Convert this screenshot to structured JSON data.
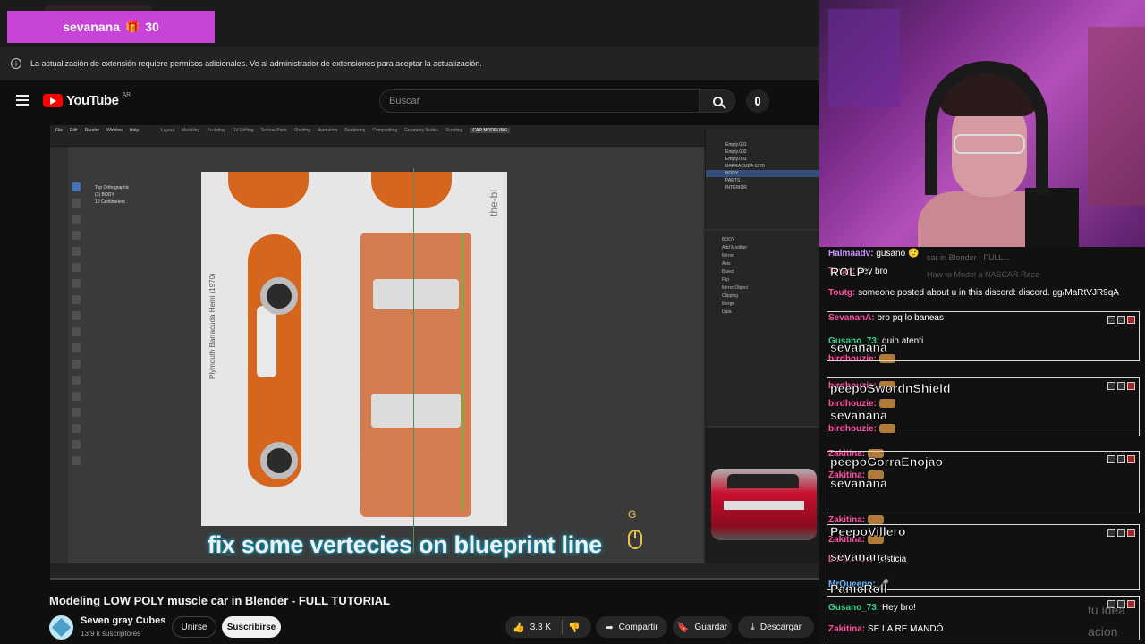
{
  "overlay": {
    "user": "sevanana",
    "gift_icon": "gift-icon",
    "count": "30"
  },
  "notice": {
    "text": "La actualización de extensión requiere permisos adicionales. Ve al administrador de extensiones para aceptar la actualización."
  },
  "header": {
    "logo": "YouTube",
    "country": "AR",
    "search_placeholder": "Buscar"
  },
  "video": {
    "subtitle": "fix some vertecies on blueprint line",
    "key_hint": "G",
    "progress": 0.0,
    "blender": {
      "menu": [
        "File",
        "Edit",
        "Render",
        "Window",
        "Help"
      ],
      "tabs": [
        "Layout",
        "Modeling",
        "Sculpting",
        "UV Editing",
        "Texture Paint",
        "Shading",
        "Animation",
        "Rendering",
        "Compositing",
        "Geometry Nodes",
        "Scripting",
        "CAR MODELING"
      ],
      "active_tab": "CAR MODELING",
      "view_info": [
        "Top Orthographic",
        "(1) BODY",
        "10 Centimeters"
      ],
      "outliner": [
        "Empty.001",
        "Empty.002",
        "Empty.003",
        "BARRACUDA 1970",
        "BODY",
        "PARTS",
        "INTERIOR"
      ],
      "selected_outliner": "BODY",
      "properties": [
        "BODY",
        "Add Modifier",
        "Mirror",
        "Axis",
        "Bisect",
        "Flip",
        "Mirror Object",
        "Clipping",
        "Merge",
        "Data"
      ],
      "blueprint_title": "Plymouth Barracuda Hemi (1970)",
      "blueprint_brand": "the-bl"
    }
  },
  "below": {
    "title": "Modeling LOW POLY muscle car in Blender - FULL TUTORIAL",
    "channel": "Seven gray Cubes",
    "subs": "13.9 k suscriptores",
    "join": "Unirse",
    "subscribe": "Suscribirse",
    "likes": "3.3 K",
    "share": "Compartir",
    "save": "Guardar",
    "download": "Descargar"
  },
  "chat": {
    "ghost": "car in Blender - FULL...",
    "ghost2": "How to Model a NASCAR Race",
    "lines": [
      {
        "user": "Halmaadv:",
        "msg": "gusano 🙂"
      },
      {
        "user": "Toutg:",
        "msg": "hey bro"
      },
      {
        "user": "Toutg:",
        "msg": "someone posted about u in this discord: discord. gg/MaRtVJR9qA"
      },
      {
        "user": "SevananA:",
        "msg": "bro pq lo baneas"
      },
      {
        "user": "Gusano_73:",
        "msg": "quin atenti"
      },
      {
        "user": "birdhouzie:",
        "msg": ""
      },
      {
        "user": "birdhouzie:",
        "msg": ""
      },
      {
        "user": "birdhouzie:",
        "msg": ""
      },
      {
        "user": "birdhouzie:",
        "msg": ""
      },
      {
        "user": "Zakitina:",
        "msg": ""
      },
      {
        "user": "Zakitina:",
        "msg": ""
      },
      {
        "user": "Zakitina:",
        "msg": ""
      },
      {
        "user": "Zakitina:",
        "msg": ""
      },
      {
        "user": "birdhouzie:",
        "msg": "justicia"
      },
      {
        "user": "MrQueenn:",
        "msg": "🎤"
      },
      {
        "user": "Gusano_73:",
        "msg": "Hey bro!"
      },
      {
        "user": "Zakitina:",
        "msg": "SE LA RE MANDÓ"
      }
    ],
    "emotes": [
      "sevanana",
      "peepoSwordnShield",
      "sevanana",
      "peepoGorraEnojao",
      "sevanana",
      "PeepoVillero",
      "sevanana",
      "PanicRoll",
      "ROLP"
    ],
    "footer_ghost": "tu idea",
    "footer_ghost2": "acion"
  },
  "colors": {
    "accent": "#ff0000",
    "badge": "#c844d8",
    "subtitle_glow": "#0aa4c8"
  }
}
